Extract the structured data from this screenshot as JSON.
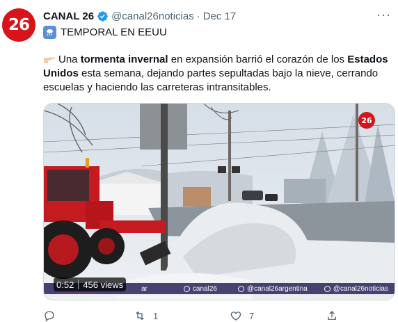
{
  "tweet": {
    "avatar_text": "26",
    "display_name": "CANAL 26",
    "handle": "@canal26noticias",
    "separator": "·",
    "date": "Dec 17",
    "more": "···",
    "subtitle": "TEMPORAL EN EEUU",
    "body": {
      "part1": "Una ",
      "bold1": "tormenta invernal",
      "part2": " en expansión barrió el corazón de los ",
      "bold2": "Estados Unidos",
      "part3": " esta semana, dejando partes sepultadas bajo la nieve, cerrando escuelas y haciendo las carreteras intransitables."
    }
  },
  "video": {
    "badge": "26",
    "duration": "0:52",
    "views": "456 views",
    "progress": 0.12,
    "ticker": [
      "ar",
      "canal26",
      "@canal26argentina",
      "@canal26noticias"
    ]
  },
  "actions": {
    "reply_count": "",
    "retweet_count": "1",
    "like_count": "7",
    "share_count": ""
  },
  "colors": {
    "brand_red": "#d7141a",
    "verified_blue": "#1d9bf0",
    "muted_text": "#536471"
  },
  "icons": [
    "verified-badge-icon",
    "cloud-rain-emoji-icon",
    "pointing-hand-emoji-icon",
    "more-icon",
    "reply-icon",
    "retweet-icon",
    "like-icon",
    "share-icon"
  ]
}
